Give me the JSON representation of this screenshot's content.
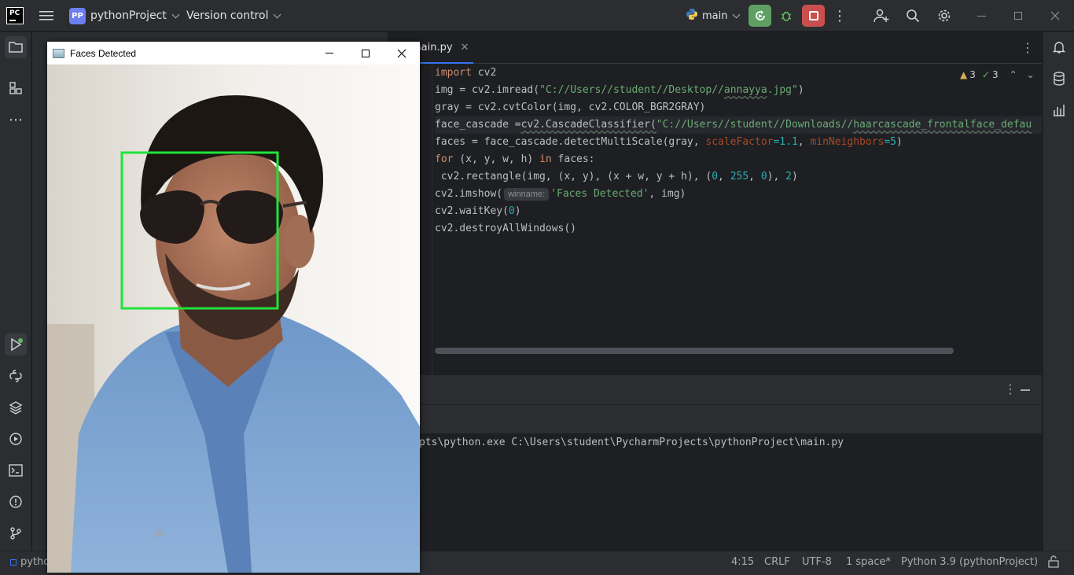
{
  "titlebar": {
    "app_logo": "PC",
    "project_badge": "PP",
    "project_name": "pythonProject",
    "version_control": "Version control",
    "branch": "main"
  },
  "editor": {
    "tab_label": "main.py",
    "warnings": "3",
    "checks": "3",
    "code": {
      "l1_kw": "import",
      "l1_rest": " cv2",
      "l2_a": "img = cv2.imread(",
      "l2_s1": "\"C://Users//student//Desktop//",
      "l2_s2": "annayya",
      "l2_s3": ".jpg\"",
      "l2_b": ")",
      "l3": "gray = cv2.cvtColor(img, cv2.COLOR_BGR2GRAY)",
      "l4_a": "face_cascade =",
      "l4_b": "cv2.CascadeClassifier(",
      "l4_s1": "\"C://Users//student//Downloads//",
      "l4_s2": "haarcascade_frontalface_defau",
      "l5_a": "faces = face_cascade.detectMultiScale(gray, ",
      "l5_p1": "scaleFactor",
      "l5_n1": "=1.1",
      "l5_c": ", ",
      "l5_p2": "minNeighbors",
      "l5_n2": "=5",
      "l5_e": ")",
      "l6_kw1": "for",
      "l6_a": " (x, y, w, h) ",
      "l6_kw2": "in",
      "l6_b": " faces:",
      "l7_a": " cv2.rectangle(img, (x, y), (x + w, y + h), (",
      "l7_n1": "0",
      "l7_c1": ", ",
      "l7_n2": "255",
      "l7_c2": ", ",
      "l7_n3": "0",
      "l7_c3": "), ",
      "l7_n4": "2",
      "l7_e": ")",
      "l8_a": "cv2.imshow(",
      "l8_hint": "winname:",
      "l8_s": "'Faces Detected'",
      "l8_b": ", img)",
      "l9_a": "cv2.waitKey(",
      "l9_n": "0",
      "l9_b": ")",
      "l10": "cv2.destroyAllWindows()"
    }
  },
  "console": {
    "line": "pts\\python.exe C:\\Users\\student\\PycharmProjects\\pythonProject\\main.py"
  },
  "statusbar": {
    "left": "pytho",
    "position": "4:15",
    "line_sep": "CRLF",
    "encoding": "UTF-8",
    "indent": "1 space*",
    "interpreter": "Python 3.9 (pythonProject)"
  },
  "cv_window": {
    "title": "Faces Detected",
    "detection_color": "#21e33a"
  }
}
